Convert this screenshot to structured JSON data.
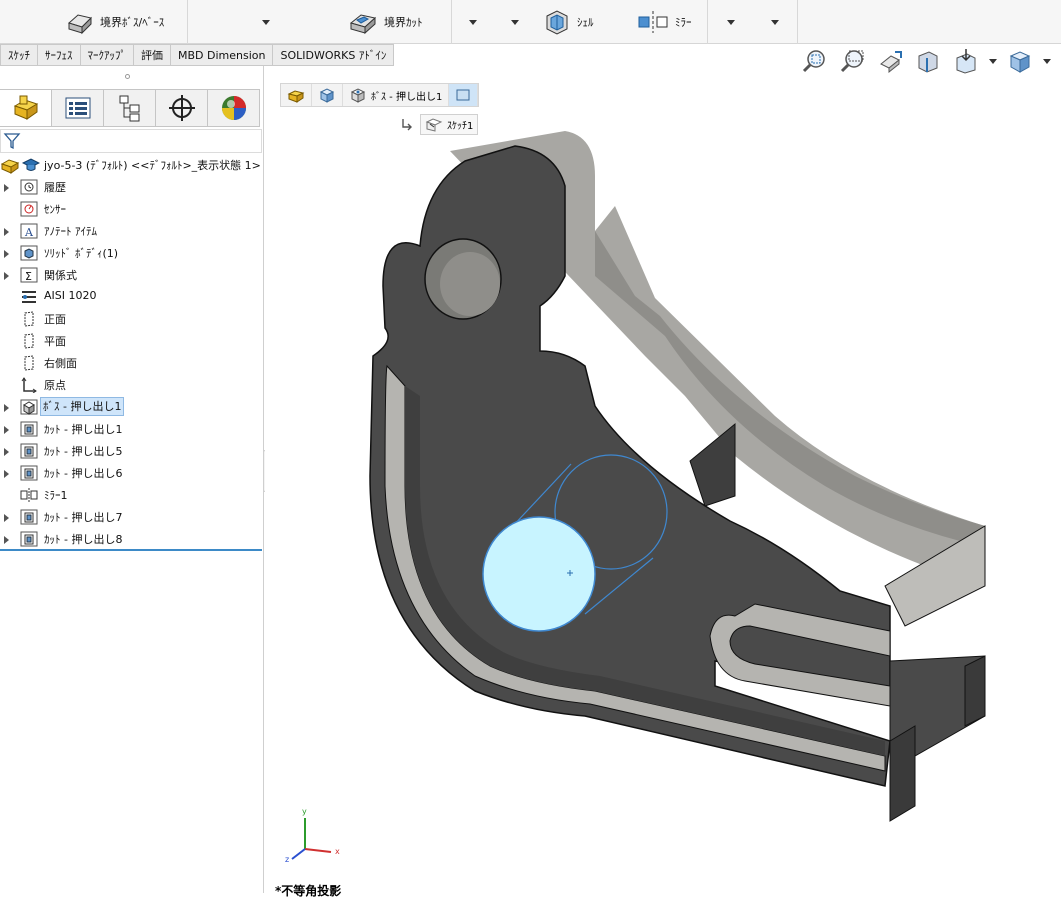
{
  "toolbar": {
    "boundary_boss": "境界ﾎﾞｽ/ﾍﾞｰｽ",
    "boundary_cut": "境界ｶｯﾄ",
    "shell": "ｼｪﾙ",
    "mirror": "ﾐﾗｰ"
  },
  "tabs": [
    "ｽｹｯﾁ",
    "ｻｰﾌｪｽ",
    "ﾏｰｸｱｯﾌﾟ",
    "評価",
    "MBD Dimension",
    "SOLIDWORKS ｱﾄﾞｲﾝ"
  ],
  "tree": {
    "root": "jyo-5-3 (ﾃﾞﾌｫﾙﾄ) <<ﾃﾞﾌｫﾙﾄ>_表示状態 1>",
    "items": [
      {
        "label": "履歴",
        "icon": "history-icon",
        "expand": true
      },
      {
        "label": "ｾﾝｻｰ",
        "icon": "sensor-icon",
        "expand": false
      },
      {
        "label": "ｱﾉﾃｰﾄ ｱｲﾃﾑ",
        "icon": "annotation-icon",
        "expand": true
      },
      {
        "label": "ｿﾘｯﾄﾞ ﾎﾞﾃﾞｨ(1)",
        "icon": "solid-body-icon",
        "expand": true
      },
      {
        "label": "関係式",
        "icon": "equation-icon",
        "expand": true
      },
      {
        "label": "AISI 1020",
        "icon": "material-icon",
        "expand": false
      },
      {
        "label": "正面",
        "icon": "plane-icon",
        "expand": false
      },
      {
        "label": "平面",
        "icon": "plane-icon",
        "expand": false
      },
      {
        "label": "右側面",
        "icon": "plane-icon",
        "expand": false
      },
      {
        "label": "原点",
        "icon": "origin-icon",
        "expand": false
      },
      {
        "label": "ﾎﾞｽ - 押し出し1",
        "icon": "boss-extrude-icon",
        "expand": true,
        "selected": true
      },
      {
        "label": "ｶｯﾄ - 押し出し1",
        "icon": "cut-extrude-icon",
        "expand": true
      },
      {
        "label": "ｶｯﾄ - 押し出し5",
        "icon": "cut-extrude-icon",
        "expand": true
      },
      {
        "label": "ｶｯﾄ - 押し出し6",
        "icon": "cut-extrude-icon",
        "expand": true
      },
      {
        "label": "ﾐﾗｰ1",
        "icon": "mirror-icon",
        "expand": false
      },
      {
        "label": "ｶｯﾄ - 押し出し7",
        "icon": "cut-extrude-icon",
        "expand": true
      },
      {
        "label": "ｶｯﾄ - 押し出し8",
        "icon": "cut-extrude-icon",
        "expand": true
      }
    ]
  },
  "breadcrumb": {
    "feature": "ﾎﾞｽ - 押し出し1",
    "sketch": "ｽｹｯﾁ1"
  },
  "triad": {
    "x": "x",
    "y": "y",
    "z": "z"
  },
  "projection_label": "*不等角投影",
  "colors": {
    "accent": "#3d8ac7",
    "selection": "#cfe5fa",
    "part": "#4a4a4a"
  }
}
